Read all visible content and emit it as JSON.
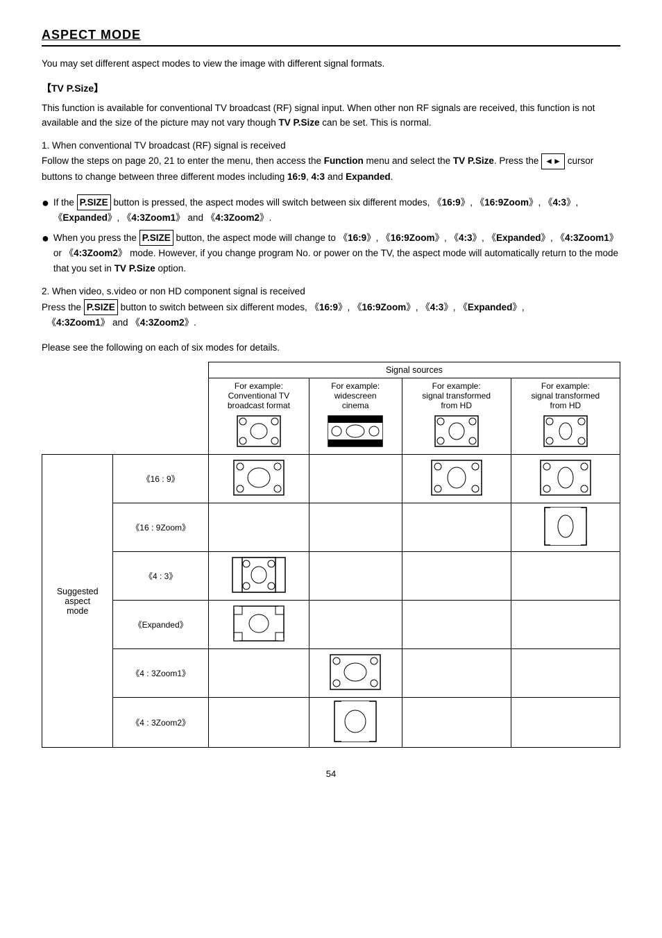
{
  "title": "ASPECT MODE",
  "intro": "You may set different aspect modes to view the image with different signal formats.",
  "tv_psize_heading": "【TV P.Size】",
  "tv_psize_desc": "This function is available for conventional TV broadcast (RF) signal input. When other non RF signals are received, this function is not available and the size of the picture may not vary though TV P.Size can be set. This is normal.",
  "step1_heading": "1. When conventional TV broadcast (RF) signal is received",
  "step1_desc": "Follow the steps on page 20, 21 to enter the menu, then access the Function menu and select the TV P.Size. Press the",
  "step1_desc2": "cursor buttons to change between three different modes including 16:9, 4:3 and Expanded.",
  "bullet1": "If the P.SIZE button is pressed, the aspect modes will switch between six different modes, 《16:9》, 《16:9Zoom》, 《4:3》, 《Expanded》, 《4:3Zoom1》 and 《4:3Zoom2》.",
  "bullet2": "When you press the P.SIZE button, the aspect mode will change to 《16:9》, 《16:9Zoom》, 《4:3》, 《Expanded》, 《4:3Zoom1》 or 《4:3Zoom2》 mode. However, if you change program No. or power on the TV, the aspect mode will automatically return to the mode that you set in TV P.Size option.",
  "step2_heading": "2. When video, s.video or non HD component signal is received",
  "step2_desc": "Press the P.SIZE button to switch between six different modes, 《16:9》, 《16:9Zoom》, 《4:3》, 《Expanded》, 《4:3Zoom1》 and 《4:3Zoom2》.",
  "table_note": "Please see the following on each of six modes for details.",
  "signal_sources": "Signal sources",
  "col1_header": "For example:\nConventional TV\nbroadcast format",
  "col2_header": "For example:\nwidescreen\ncinema",
  "col3_header": "For example:\nsignal transformed\nfrom HD",
  "col4_header": "For example:\nsignal transformed\nfrom HD",
  "suggested_label": "Suggested\naspect\nmode",
  "modes": [
    "《16 : 9》",
    "《16 : 9Zoom》",
    "《4 : 3》",
    "《Expanded》",
    "《4 : 3Zoom1》",
    "《4 : 3Zoom2》"
  ],
  "page_number": "54"
}
